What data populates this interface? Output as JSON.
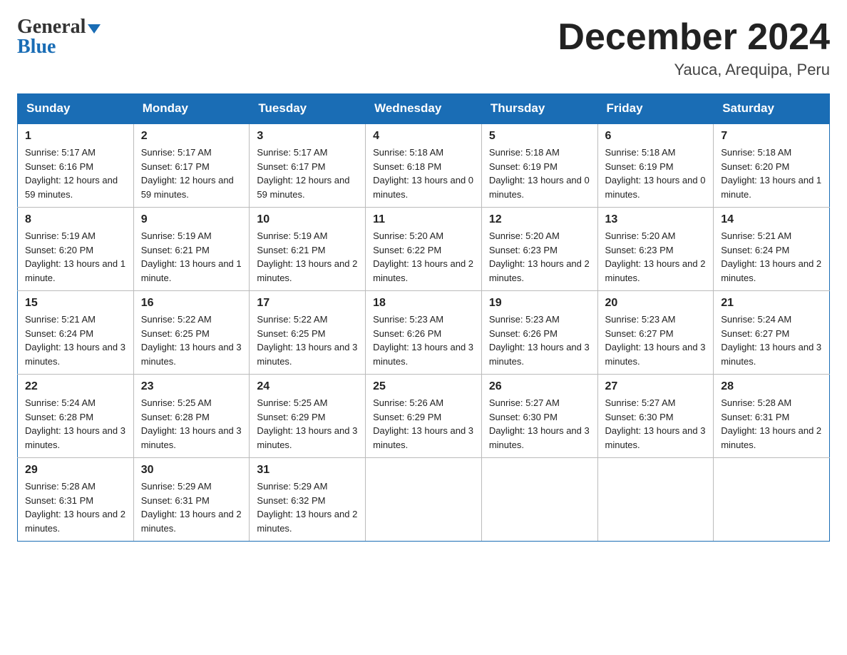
{
  "header": {
    "logo_line1": "General",
    "logo_line2": "Blue",
    "month_title": "December 2024",
    "location": "Yauca, Arequipa, Peru"
  },
  "weekdays": [
    "Sunday",
    "Monday",
    "Tuesday",
    "Wednesday",
    "Thursday",
    "Friday",
    "Saturday"
  ],
  "weeks": [
    [
      {
        "day": "1",
        "sunrise": "5:17 AM",
        "sunset": "6:16 PM",
        "daylight": "12 hours and 59 minutes."
      },
      {
        "day": "2",
        "sunrise": "5:17 AM",
        "sunset": "6:17 PM",
        "daylight": "12 hours and 59 minutes."
      },
      {
        "day": "3",
        "sunrise": "5:17 AM",
        "sunset": "6:17 PM",
        "daylight": "12 hours and 59 minutes."
      },
      {
        "day": "4",
        "sunrise": "5:18 AM",
        "sunset": "6:18 PM",
        "daylight": "13 hours and 0 minutes."
      },
      {
        "day": "5",
        "sunrise": "5:18 AM",
        "sunset": "6:19 PM",
        "daylight": "13 hours and 0 minutes."
      },
      {
        "day": "6",
        "sunrise": "5:18 AM",
        "sunset": "6:19 PM",
        "daylight": "13 hours and 0 minutes."
      },
      {
        "day": "7",
        "sunrise": "5:18 AM",
        "sunset": "6:20 PM",
        "daylight": "13 hours and 1 minute."
      }
    ],
    [
      {
        "day": "8",
        "sunrise": "5:19 AM",
        "sunset": "6:20 PM",
        "daylight": "13 hours and 1 minute."
      },
      {
        "day": "9",
        "sunrise": "5:19 AM",
        "sunset": "6:21 PM",
        "daylight": "13 hours and 1 minute."
      },
      {
        "day": "10",
        "sunrise": "5:19 AM",
        "sunset": "6:21 PM",
        "daylight": "13 hours and 2 minutes."
      },
      {
        "day": "11",
        "sunrise": "5:20 AM",
        "sunset": "6:22 PM",
        "daylight": "13 hours and 2 minutes."
      },
      {
        "day": "12",
        "sunrise": "5:20 AM",
        "sunset": "6:23 PM",
        "daylight": "13 hours and 2 minutes."
      },
      {
        "day": "13",
        "sunrise": "5:20 AM",
        "sunset": "6:23 PM",
        "daylight": "13 hours and 2 minutes."
      },
      {
        "day": "14",
        "sunrise": "5:21 AM",
        "sunset": "6:24 PM",
        "daylight": "13 hours and 2 minutes."
      }
    ],
    [
      {
        "day": "15",
        "sunrise": "5:21 AM",
        "sunset": "6:24 PM",
        "daylight": "13 hours and 3 minutes."
      },
      {
        "day": "16",
        "sunrise": "5:22 AM",
        "sunset": "6:25 PM",
        "daylight": "13 hours and 3 minutes."
      },
      {
        "day": "17",
        "sunrise": "5:22 AM",
        "sunset": "6:25 PM",
        "daylight": "13 hours and 3 minutes."
      },
      {
        "day": "18",
        "sunrise": "5:23 AM",
        "sunset": "6:26 PM",
        "daylight": "13 hours and 3 minutes."
      },
      {
        "day": "19",
        "sunrise": "5:23 AM",
        "sunset": "6:26 PM",
        "daylight": "13 hours and 3 minutes."
      },
      {
        "day": "20",
        "sunrise": "5:23 AM",
        "sunset": "6:27 PM",
        "daylight": "13 hours and 3 minutes."
      },
      {
        "day": "21",
        "sunrise": "5:24 AM",
        "sunset": "6:27 PM",
        "daylight": "13 hours and 3 minutes."
      }
    ],
    [
      {
        "day": "22",
        "sunrise": "5:24 AM",
        "sunset": "6:28 PM",
        "daylight": "13 hours and 3 minutes."
      },
      {
        "day": "23",
        "sunrise": "5:25 AM",
        "sunset": "6:28 PM",
        "daylight": "13 hours and 3 minutes."
      },
      {
        "day": "24",
        "sunrise": "5:25 AM",
        "sunset": "6:29 PM",
        "daylight": "13 hours and 3 minutes."
      },
      {
        "day": "25",
        "sunrise": "5:26 AM",
        "sunset": "6:29 PM",
        "daylight": "13 hours and 3 minutes."
      },
      {
        "day": "26",
        "sunrise": "5:27 AM",
        "sunset": "6:30 PM",
        "daylight": "13 hours and 3 minutes."
      },
      {
        "day": "27",
        "sunrise": "5:27 AM",
        "sunset": "6:30 PM",
        "daylight": "13 hours and 3 minutes."
      },
      {
        "day": "28",
        "sunrise": "5:28 AM",
        "sunset": "6:31 PM",
        "daylight": "13 hours and 2 minutes."
      }
    ],
    [
      {
        "day": "29",
        "sunrise": "5:28 AM",
        "sunset": "6:31 PM",
        "daylight": "13 hours and 2 minutes."
      },
      {
        "day": "30",
        "sunrise": "5:29 AM",
        "sunset": "6:31 PM",
        "daylight": "13 hours and 2 minutes."
      },
      {
        "day": "31",
        "sunrise": "5:29 AM",
        "sunset": "6:32 PM",
        "daylight": "13 hours and 2 minutes."
      },
      null,
      null,
      null,
      null
    ]
  ]
}
